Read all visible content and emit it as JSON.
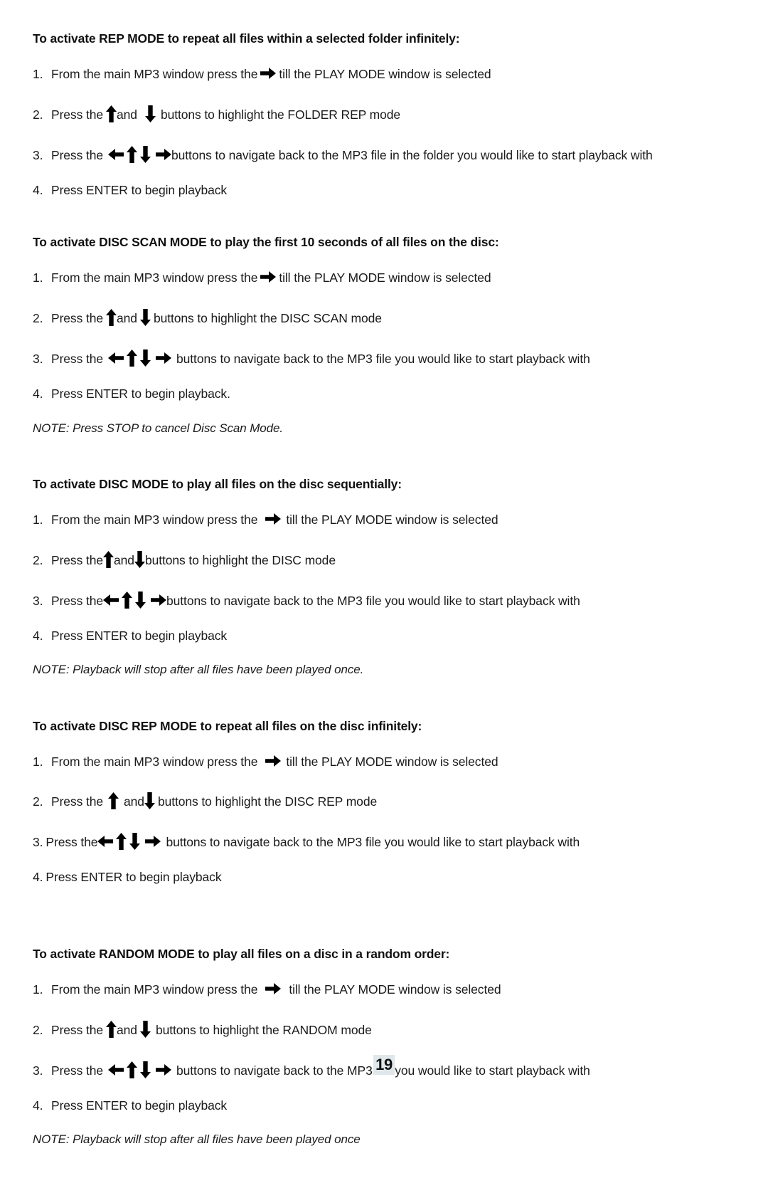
{
  "document": {
    "page_number": "19",
    "page_number_highlight": "#dfe7ea"
  },
  "icons": {
    "right": "arrow-right-icon",
    "left": "arrow-left-icon",
    "up": "arrow-up-icon",
    "down": "arrow-down-icon"
  },
  "sections": [
    {
      "heading": "To activate REP MODE to repeat all files within a selected folder infinitely:",
      "steps": [
        {
          "num": "1.",
          "before": "From the main MP3 window press the",
          "after": "till the PLAY MODE window is selected"
        },
        {
          "num": "2.",
          "before": "Press the",
          "middle": "and",
          "after": "buttons to highlight the FOLDER REP mode"
        },
        {
          "num": "3.",
          "before": "Press the",
          "after": "buttons to navigate back to the MP3 file in the folder you would like to start playback with"
        },
        {
          "num": "4.",
          "before": "Press ENTER to begin playback"
        }
      ],
      "note": null
    },
    {
      "heading": "To activate DISC SCAN MODE to play the first 10 seconds of all files on the disc:",
      "steps": [
        {
          "num": "1.",
          "before": "From the main MP3 window press the",
          "after": "till the PLAY MODE window is selected"
        },
        {
          "num": "2.",
          "before": "Press the",
          "middle": "and",
          "after": "buttons to highlight the DISC SCAN mode"
        },
        {
          "num": "3.",
          "before": "Press the",
          "after": "buttons to navigate back to the MP3 file you would like to start playback with"
        },
        {
          "num": "4.",
          "before": "Press ENTER to begin playback."
        }
      ],
      "note": "NOTE: Press STOP to cancel Disc Scan Mode."
    },
    {
      "heading": "To activate DISC MODE to play all files on the disc sequentially:",
      "steps": [
        {
          "num": "1.",
          "before": "From the main MP3 window press the",
          "after": "till the PLAY MODE window is selected"
        },
        {
          "num": "2.",
          "before": "Press the",
          "middle": "and",
          "after": "buttons to highlight the DISC mode"
        },
        {
          "num": "3.",
          "before": "Press the",
          "after": "buttons to navigate back to the MP3 file you would like to start playback with"
        },
        {
          "num": "4.",
          "before": "Press ENTER to begin playback"
        }
      ],
      "note": "NOTE: Playback will stop after all files have been played once."
    },
    {
      "heading": "To activate DISC REP MODE to repeat all files on the disc infinitely:",
      "steps": [
        {
          "num": "1.",
          "before": "From the main MP3 window press the",
          "after": "till the PLAY MODE window is selected"
        },
        {
          "num": "2.",
          "before": "Press the",
          "middle": "and",
          "after": "buttons to highlight the DISC REP mode"
        },
        {
          "num": "3.",
          "before": "Press the",
          "after": "buttons to navigate back to the MP3 file you would like to start playback with"
        },
        {
          "num": "4.",
          "before": "Press ENTER to begin playback"
        }
      ],
      "note": null
    },
    {
      "heading": "To activate RANDOM MODE to play all files on a disc in a random order:",
      "steps": [
        {
          "num": "1.",
          "before": "From the main MP3 window press the",
          "after": "till the PLAY MODE window is selected"
        },
        {
          "num": "2.",
          "before": "Press the",
          "middle": "and",
          "after": "buttons to highlight the RANDOM mode"
        },
        {
          "num": "3.",
          "before": "Press the",
          "after": "buttons to navigate back to the MP3 file you would like to start playback with"
        },
        {
          "num": "4.",
          "before": "Press ENTER to begin playback"
        }
      ],
      "note": "NOTE: Playback will stop after all files have been played once"
    }
  ]
}
